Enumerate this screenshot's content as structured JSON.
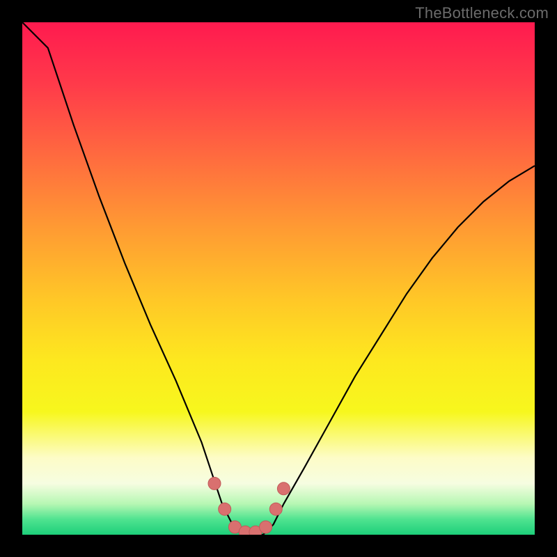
{
  "watermark": "TheBottleneck.com",
  "colors": {
    "curve_stroke": "#000000",
    "marker_fill": "#d9706f",
    "marker_stroke": "#c05a59"
  },
  "chart_data": {
    "type": "line",
    "title": "",
    "xlabel": "",
    "ylabel": "",
    "xlim": [
      0,
      100
    ],
    "ylim": [
      0,
      100
    ],
    "series": [
      {
        "name": "bottleneck-curve",
        "x": [
          0,
          5,
          10,
          15,
          20,
          25,
          30,
          35,
          37,
          39,
          41,
          43,
          45,
          47,
          49,
          51,
          55,
          60,
          65,
          70,
          75,
          80,
          85,
          90,
          95,
          100
        ],
        "values": [
          110,
          95,
          80,
          66,
          53,
          41,
          30,
          18,
          12,
          6,
          2,
          0,
          0,
          0,
          2,
          6,
          13,
          22,
          31,
          39,
          47,
          54,
          60,
          65,
          69,
          72
        ]
      }
    ],
    "markers": {
      "name": "trough-markers",
      "x": [
        37.5,
        39.5,
        41.5,
        43.5,
        45.5,
        47.5,
        49.5,
        51.0
      ],
      "values": [
        10,
        5,
        1.5,
        0.5,
        0.5,
        1.5,
        5,
        9
      ]
    }
  }
}
